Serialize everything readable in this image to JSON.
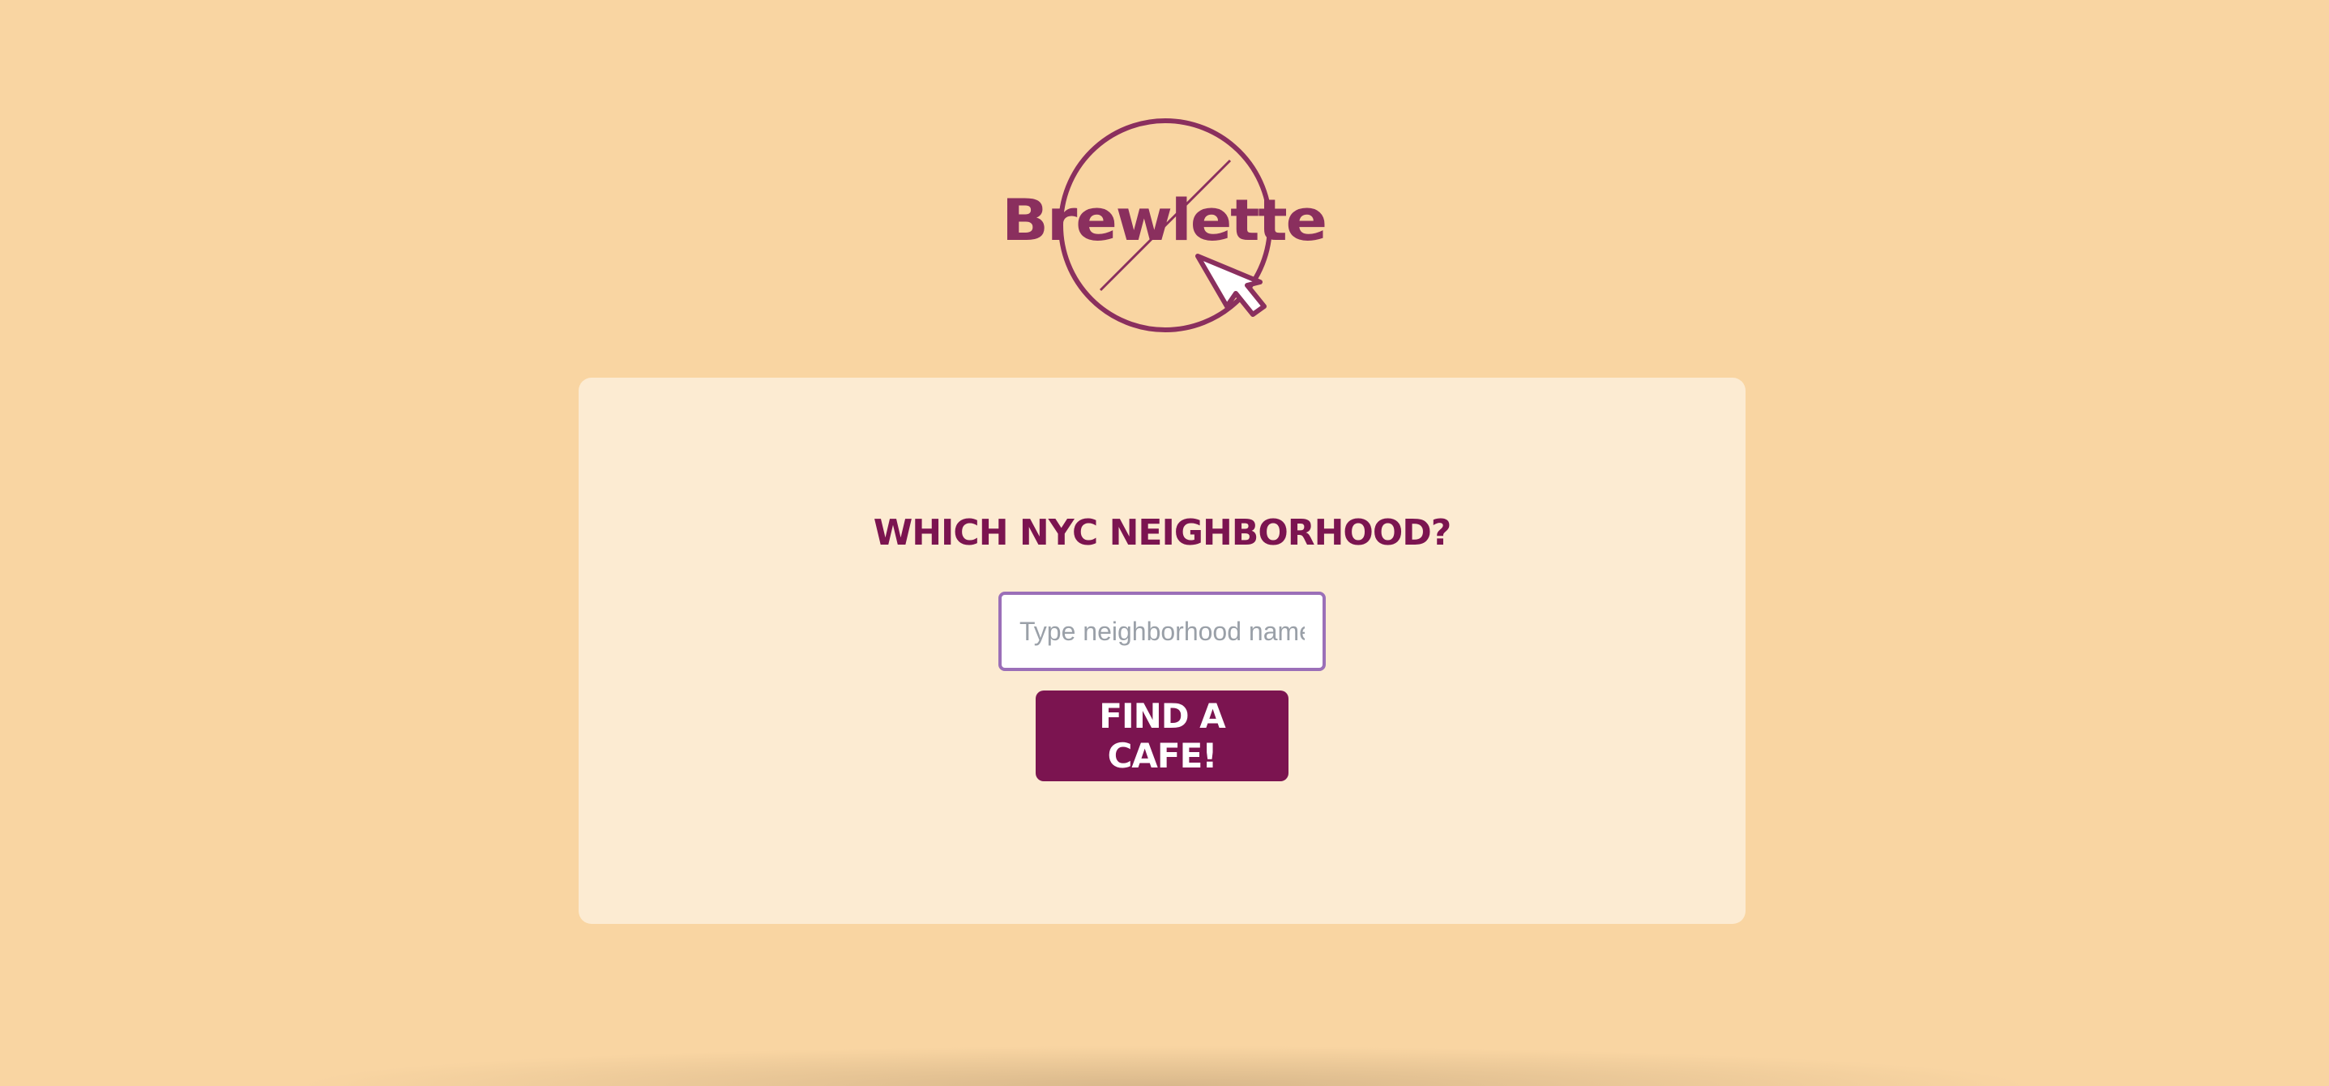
{
  "brand": {
    "name": "Brewlette",
    "logo_color": "#8a2f5e"
  },
  "search": {
    "question": "WHICH NYC NEIGHBORHOOD?",
    "placeholder": "Type neighborhood name",
    "value": ""
  },
  "actions": {
    "find_label": "FIND A CAFE!"
  },
  "colors": {
    "page_background": "#f9d5a2",
    "card_background": "#fcebd2",
    "accent": "#7b1450",
    "input_border": "#9b6fb8"
  }
}
